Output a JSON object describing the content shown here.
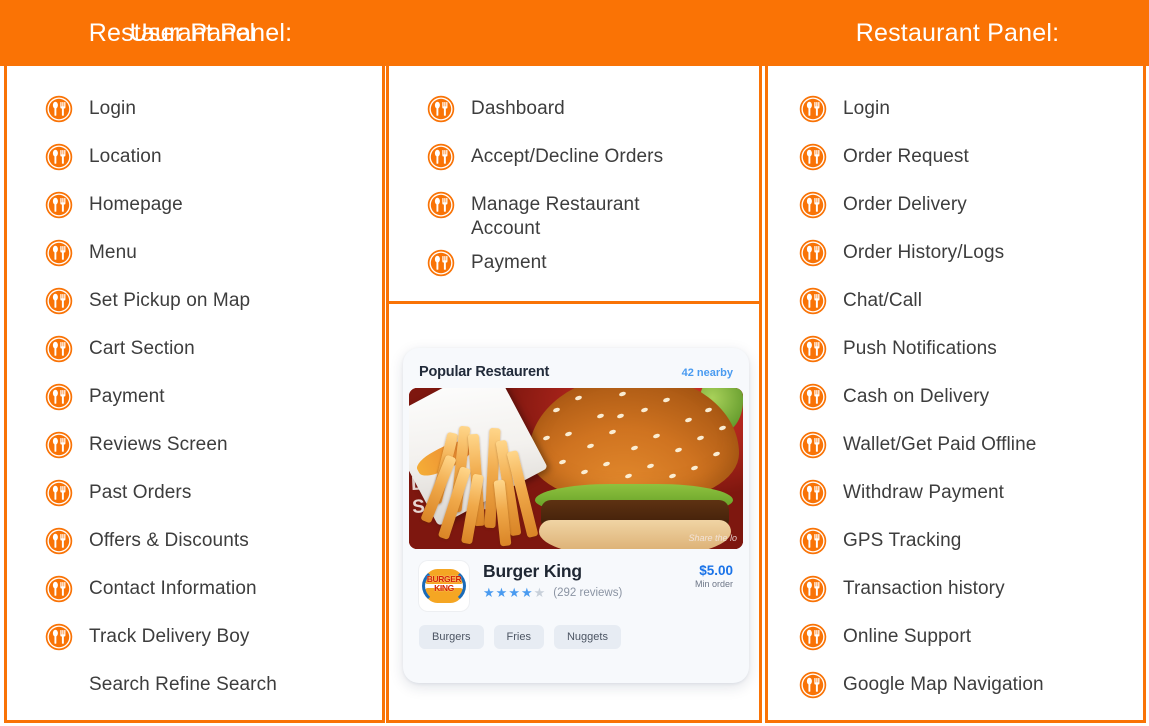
{
  "headers": {
    "user_panel": "User Panel",
    "restaurant_panel": "Restaurant Panel:",
    "delivery_panel": "Restaurant Panel:"
  },
  "user_panel": {
    "items": [
      {
        "label": "Login",
        "icon": "cutlery-icon",
        "has_icon": true
      },
      {
        "label": "Location",
        "icon": "cutlery-icon",
        "has_icon": true
      },
      {
        "label": "Homepage",
        "icon": "cutlery-icon",
        "has_icon": true
      },
      {
        "label": "Menu",
        "icon": "cutlery-icon",
        "has_icon": true
      },
      {
        "label": "Set Pickup on Map",
        "icon": "cutlery-icon",
        "has_icon": true
      },
      {
        "label": "Cart Section",
        "icon": "cutlery-icon",
        "has_icon": true
      },
      {
        "label": "Payment",
        "icon": "cutlery-icon",
        "has_icon": true
      },
      {
        "label": "Reviews Screen",
        "icon": "cutlery-icon",
        "has_icon": true
      },
      {
        "label": "Past Orders",
        "icon": "cutlery-icon",
        "has_icon": true
      },
      {
        "label": "Offers & Discounts",
        "icon": "cutlery-icon",
        "has_icon": true
      },
      {
        "label": "Contact Information",
        "icon": "cutlery-icon",
        "has_icon": true
      },
      {
        "label": "Track Delivery Boy",
        "icon": "cutlery-icon",
        "has_icon": true
      },
      {
        "label": "Search Refine Search",
        "icon": "none",
        "has_icon": false
      }
    ]
  },
  "restaurant_panel": {
    "items": [
      {
        "label": "Dashboard",
        "icon": "cutlery-icon",
        "has_icon": true
      },
      {
        "label": "Accept/Decline Orders",
        "icon": "cutlery-icon",
        "has_icon": true
      },
      {
        "label": "Manage Restaurant Account",
        "icon": "cutlery-icon",
        "has_icon": true
      },
      {
        "label": "Payment",
        "icon": "cutlery-icon",
        "has_icon": true
      }
    ]
  },
  "delivery_panel": {
    "items": [
      {
        "label": "Login",
        "icon": "cutlery-icon",
        "has_icon": true
      },
      {
        "label": "Order Request",
        "icon": "cutlery-icon",
        "has_icon": true
      },
      {
        "label": "Order Delivery",
        "icon": "cutlery-icon",
        "has_icon": true
      },
      {
        "label": "Order History/Logs",
        "icon": "cutlery-icon",
        "has_icon": true
      },
      {
        "label": "Chat/Call",
        "icon": "cutlery-icon",
        "has_icon": true
      },
      {
        "label": "Push Notifications",
        "icon": "cutlery-icon",
        "has_icon": true
      },
      {
        "label": "Cash on Delivery",
        "icon": "cutlery-icon",
        "has_icon": true
      },
      {
        "label": "Wallet/Get Paid Offline",
        "icon": "cutlery-icon",
        "has_icon": true
      },
      {
        "label": "Withdraw Payment",
        "icon": "cutlery-icon",
        "has_icon": true
      },
      {
        "label": "GPS Tracking",
        "icon": "cutlery-icon",
        "has_icon": true
      },
      {
        "label": "Transaction history",
        "icon": "cutlery-icon",
        "has_icon": true
      },
      {
        "label": "Online Support",
        "icon": "cutlery-icon",
        "has_icon": true
      },
      {
        "label": "Google Map Navigation",
        "icon": "cutlery-icon",
        "has_icon": true
      }
    ]
  },
  "restaurant_card": {
    "section_title": "Popular Restaurent",
    "nearby_count": "42 nearby",
    "photo_overlay_text": "GRI\nLLE\nSERVAT",
    "photo_share_text": "Share the lo",
    "logo_text_top": "BURGER",
    "logo_text_bottom": "KING",
    "name": "Burger King",
    "stars_filled": 3,
    "stars_half": 1,
    "stars_empty": 1,
    "star_glyph_full": "★",
    "star_glyph_empty": "★",
    "reviews": "(292 reviews)",
    "price": "$5.00",
    "min_order_label": "Min order",
    "tags": [
      "Burgers",
      "Fries",
      "Nuggets"
    ]
  },
  "colors": {
    "brand_orange": "#FA7305",
    "text_dark": "#3d3d3d",
    "accent_blue": "#4a9bf0",
    "price_blue": "#1a73e8",
    "card_bg": "#F7F9FC"
  }
}
